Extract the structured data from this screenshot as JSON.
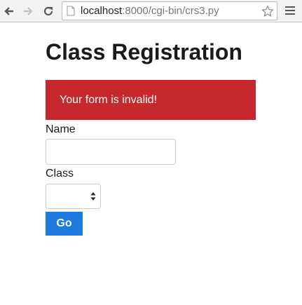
{
  "browser": {
    "url_host": "localhost",
    "url_path": ":8000/cgi-bin/crs3.py"
  },
  "page": {
    "title": "Class Registration",
    "alert_message": "Your form is invalid!",
    "name_label": "Name",
    "name_value": "",
    "class_label": "Class",
    "class_selected": "",
    "submit_label": "Go"
  },
  "colors": {
    "alert_background": "#c6282d",
    "button_background": "#1d7adf"
  },
  "icons": {
    "back": "arrow-left-icon",
    "forward": "arrow-right-icon",
    "reload": "reload-icon",
    "page": "page-icon",
    "bookmark": "star-icon",
    "menu": "hamburger-menu-icon",
    "select": "select-arrows-icon"
  }
}
